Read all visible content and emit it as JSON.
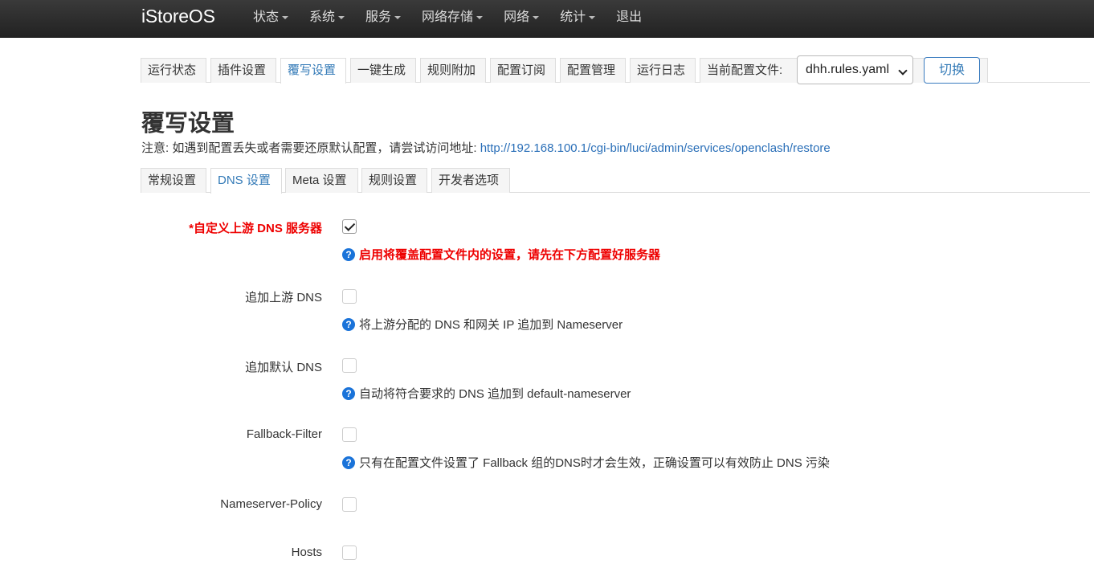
{
  "navbar": {
    "brand": "iStoreOS",
    "menu": [
      {
        "label": "状态"
      },
      {
        "label": "系统"
      },
      {
        "label": "服务"
      },
      {
        "label": "网络存储"
      },
      {
        "label": "网络"
      },
      {
        "label": "统计"
      },
      {
        "label": "退出"
      }
    ]
  },
  "primary_tabs": [
    {
      "label": "运行状态"
    },
    {
      "label": "插件设置"
    },
    {
      "label": "覆写设置",
      "active": true
    },
    {
      "label": "一键生成"
    },
    {
      "label": "规则附加"
    },
    {
      "label": "配置订阅"
    },
    {
      "label": "配置管理"
    },
    {
      "label": "运行日志"
    }
  ],
  "config_selector": {
    "label": "当前配置文件:",
    "selected": "dhh.rules.yaml",
    "switch_label": "切换"
  },
  "page": {
    "title": "覆写设置",
    "notice_prefix": "注意: 如遇到配置丢失或者需要还原默认配置，请尝试访问地址: ",
    "notice_link": "http://192.168.100.1/cgi-bin/luci/admin/services/openclash/restore"
  },
  "secondary_tabs": [
    {
      "label": "常规设置"
    },
    {
      "label": "DNS 设置",
      "active": true
    },
    {
      "label": "Meta 设置"
    },
    {
      "label": "规则设置"
    },
    {
      "label": "开发者选项"
    }
  ],
  "fields": [
    {
      "label": "自定义上游 DNS 服务器",
      "required_mark": "*",
      "checked": true,
      "help": "启用将覆盖配置文件内的设置，请先在下方配置好服务器",
      "help_warning": true
    },
    {
      "label": "追加上游 DNS",
      "checked": false,
      "help": "将上游分配的 DNS 和网关 IP 追加到 Nameserver"
    },
    {
      "label": "追加默认 DNS",
      "checked": false,
      "help": "自动将符合要求的 DNS 追加到 default-nameserver"
    },
    {
      "label": "Fallback-Filter",
      "checked": false,
      "help": "只有在配置文件设置了 Fallback 组的DNS时才会生效，正确设置可以有效防止 DNS 污染"
    },
    {
      "label": "Nameserver-Policy",
      "checked": false
    },
    {
      "label": "Hosts",
      "checked": false
    }
  ],
  "icons": {
    "help": "help-circle-icon",
    "dropdown": "chevron-down-icon",
    "menu_caret": "caret-down-icon"
  },
  "colors": {
    "navbar": "#2a2a2a",
    "link": "#337ab7",
    "warning": "#e00000",
    "help_icon": "#1a73d9"
  }
}
